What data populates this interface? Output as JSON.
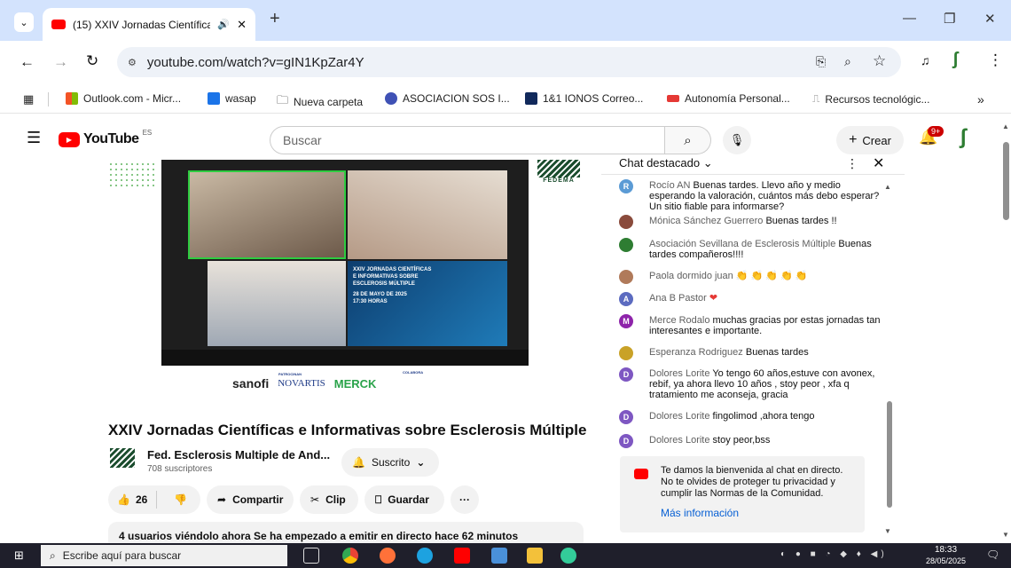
{
  "browser": {
    "tab_title": "(15) XXIV Jornadas Científica",
    "url": "youtube.com/watch?v=gIN1KpZar4Y",
    "bookmarks": [
      "Outlook.com - Micr...",
      "wasap",
      "Nueva carpeta",
      "ASOCIACION SOS I...",
      "1&1 IONOS Correo...",
      "Autonomía Personal...",
      "Recursos tecnológic..."
    ],
    "more_bookmarks": "»",
    "new_tab": "+"
  },
  "youtube": {
    "logo_text": "YouTube",
    "logo_region": "ES",
    "search_placeholder": "Buscar",
    "create_label": "Crear",
    "notif_badge": "9+"
  },
  "video": {
    "title": "XXIV Jornadas Científicas e Informativas sobre Esclerosis Múltiple",
    "channel": "Fed. Esclerosis Multiple de And...",
    "subscribers": "708 suscriptores",
    "subscribed_label": "Suscrito",
    "likes": "26",
    "share_label": "Compartir",
    "clip_label": "Clip",
    "save_label": "Guardar",
    "more": "···",
    "description": "4 usuarios viéndolo ahora  Se ha empezado a emitir en directo hace 62 minutos",
    "sponsors": [
      "sanofi",
      "NOVARTIS",
      "MERCK"
    ],
    "sponsor_small": [
      "PATROCINAN",
      "COLABORA"
    ],
    "fedema": "FEDEMA",
    "slide": {
      "line1": "XXIV JORNADAS CIENTÍFICAS",
      "line2": "E INFORMATIVAS SOBRE",
      "line3": "ESCLEROSIS MÚLTIPLE",
      "line4": "28 DE MAYO DE 2025",
      "line5": "17:30 HORAS"
    }
  },
  "chat": {
    "header": "Chat destacado",
    "messages": [
      {
        "initial": "R",
        "author": "Rocío AN",
        "text": "Buenas tardes. Llevo año y medio esperando la valoración, cuántos más debo esperar? Un sitio fiable para informarse?",
        "color": "#5b9bd5"
      },
      {
        "initial": "",
        "author": "Mónica Sánchez Guerrero",
        "text": "Buenas tardes !!",
        "color": "#8a4b3c"
      },
      {
        "initial": "",
        "author": "Asociación Sevillana de Esclerosis Múltiple",
        "text": "Buenas tardes compañeros!!!!",
        "color": "#2e7d32"
      },
      {
        "initial": "",
        "author": "Paola dormido juan",
        "text": "👏 👏 👏 👏 👏",
        "color": "#b07a5a"
      },
      {
        "initial": "A",
        "author": "Ana B Pastor",
        "text": "❤",
        "color": "#5c6bc0"
      },
      {
        "initial": "M",
        "author": "Merce Rodalo",
        "text": "muchas gracias por estas jornadas tan interesantes e importante.",
        "color": "#8e24aa"
      },
      {
        "initial": "",
        "author": "Esperanza Rodriguez",
        "text": "Buenas tardes",
        "color": "#c9a227"
      },
      {
        "initial": "D",
        "author": "Dolores Lorite",
        "text": "Yo tengo 60 años,estuve con avonex, rebif, ya ahora llevo 10 años , stoy peor , xfa q tratamiento me aconseja, gracia",
        "color": "#7e57c2"
      },
      {
        "initial": "D",
        "author": "Dolores Lorite",
        "text": "fingolimod ,ahora tengo",
        "color": "#7e57c2"
      },
      {
        "initial": "D",
        "author": "Dolores Lorite",
        "text": "stoy peor,bss",
        "color": "#7e57c2"
      }
    ],
    "welcome_text": "Te damos la bienvenida al chat en directo. No te olvides de proteger tu privacidad y cumplir las Normas de la Comunidad.",
    "more_info": "Más información"
  },
  "taskbar": {
    "search_placeholder": "Escribe aquí para buscar",
    "time": "18:33",
    "date": "28/05/2025"
  },
  "colors": {
    "accent": "#065fd4",
    "youtube_red": "#ff0000",
    "chrome_tab": "#d3e3fd"
  }
}
